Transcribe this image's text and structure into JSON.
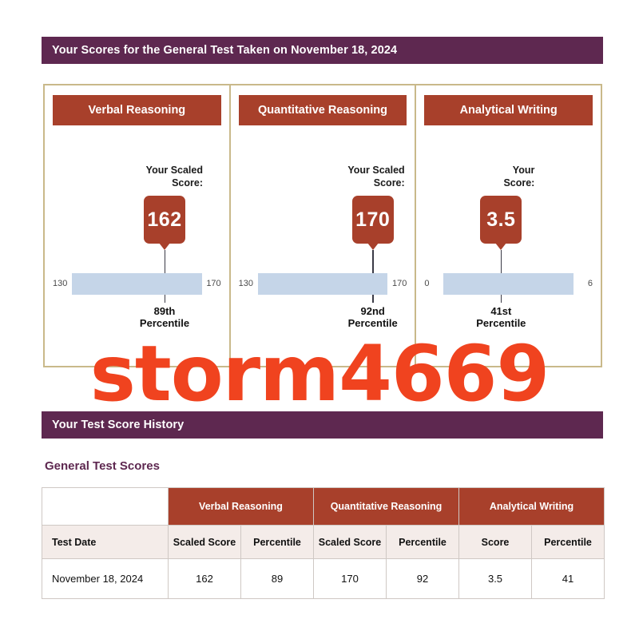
{
  "colors": {
    "banner_purple": "#5e2850",
    "card_red": "#a8402b",
    "scale_blue": "#c5d5e8",
    "frame_tan": "#c9b98a",
    "watermark_red": "#f0431f",
    "subhead_pink": "#f4ece9"
  },
  "banners": {
    "scores_title": "Your Scores for the General Test Taken on November 18, 2024",
    "history_title": "Your Test Score History"
  },
  "section_label": "General Test Scores",
  "watermark": "storm4669",
  "chart_data": {
    "type": "bar",
    "title": "Your Scores for the General Test Taken on November 18, 2024",
    "xlabel": "",
    "ylabel": "",
    "categories": [
      "Verbal Reasoning",
      "Quantitative Reasoning",
      "Analytical Writing"
    ],
    "series": [
      {
        "name": "Scaled Score",
        "values": [
          162,
          170,
          3.5
        ]
      },
      {
        "name": "Percentile",
        "values": [
          89,
          92,
          41
        ]
      }
    ],
    "axis_ranges": [
      [
        130,
        170
      ],
      [
        130,
        170
      ],
      [
        0,
        6
      ]
    ],
    "grid": false,
    "legend": "none"
  },
  "cards": [
    {
      "title": "Verbal Reasoning",
      "score_label_line1": "Your Scaled",
      "score_label_line2": "Score:",
      "score": "162",
      "scale_min": "130",
      "scale_max": "170",
      "percentile_line1": "89th",
      "percentile_line2": "Percentile",
      "marker_pct": 80
    },
    {
      "title": "Quantitative Reasoning",
      "score_label_line1": "Your Scaled",
      "score_label_line2": "Score:",
      "score": "170",
      "scale_min": "130",
      "scale_max": "170",
      "percentile_line1": "92nd",
      "percentile_line2": "Percentile",
      "marker_pct": 100
    },
    {
      "title": "Analytical Writing",
      "score_label_line1": "Your",
      "score_label_line2": "Score:",
      "score": "3.5",
      "scale_min": "0",
      "scale_max": "6",
      "percentile_line1": "41st",
      "percentile_line2": "Percentile",
      "marker_pct": 58
    }
  ],
  "table": {
    "group_headers": [
      "Verbal Reasoning",
      "Quantitative Reasoning",
      "Analytical Writing"
    ],
    "sub_headers": [
      "Test Date",
      "Scaled Score",
      "Percentile",
      "Scaled Score",
      "Percentile",
      "Score",
      "Percentile"
    ],
    "rows": [
      [
        "November 18, 2024",
        "162",
        "89",
        "170",
        "92",
        "3.5",
        "41"
      ]
    ]
  }
}
